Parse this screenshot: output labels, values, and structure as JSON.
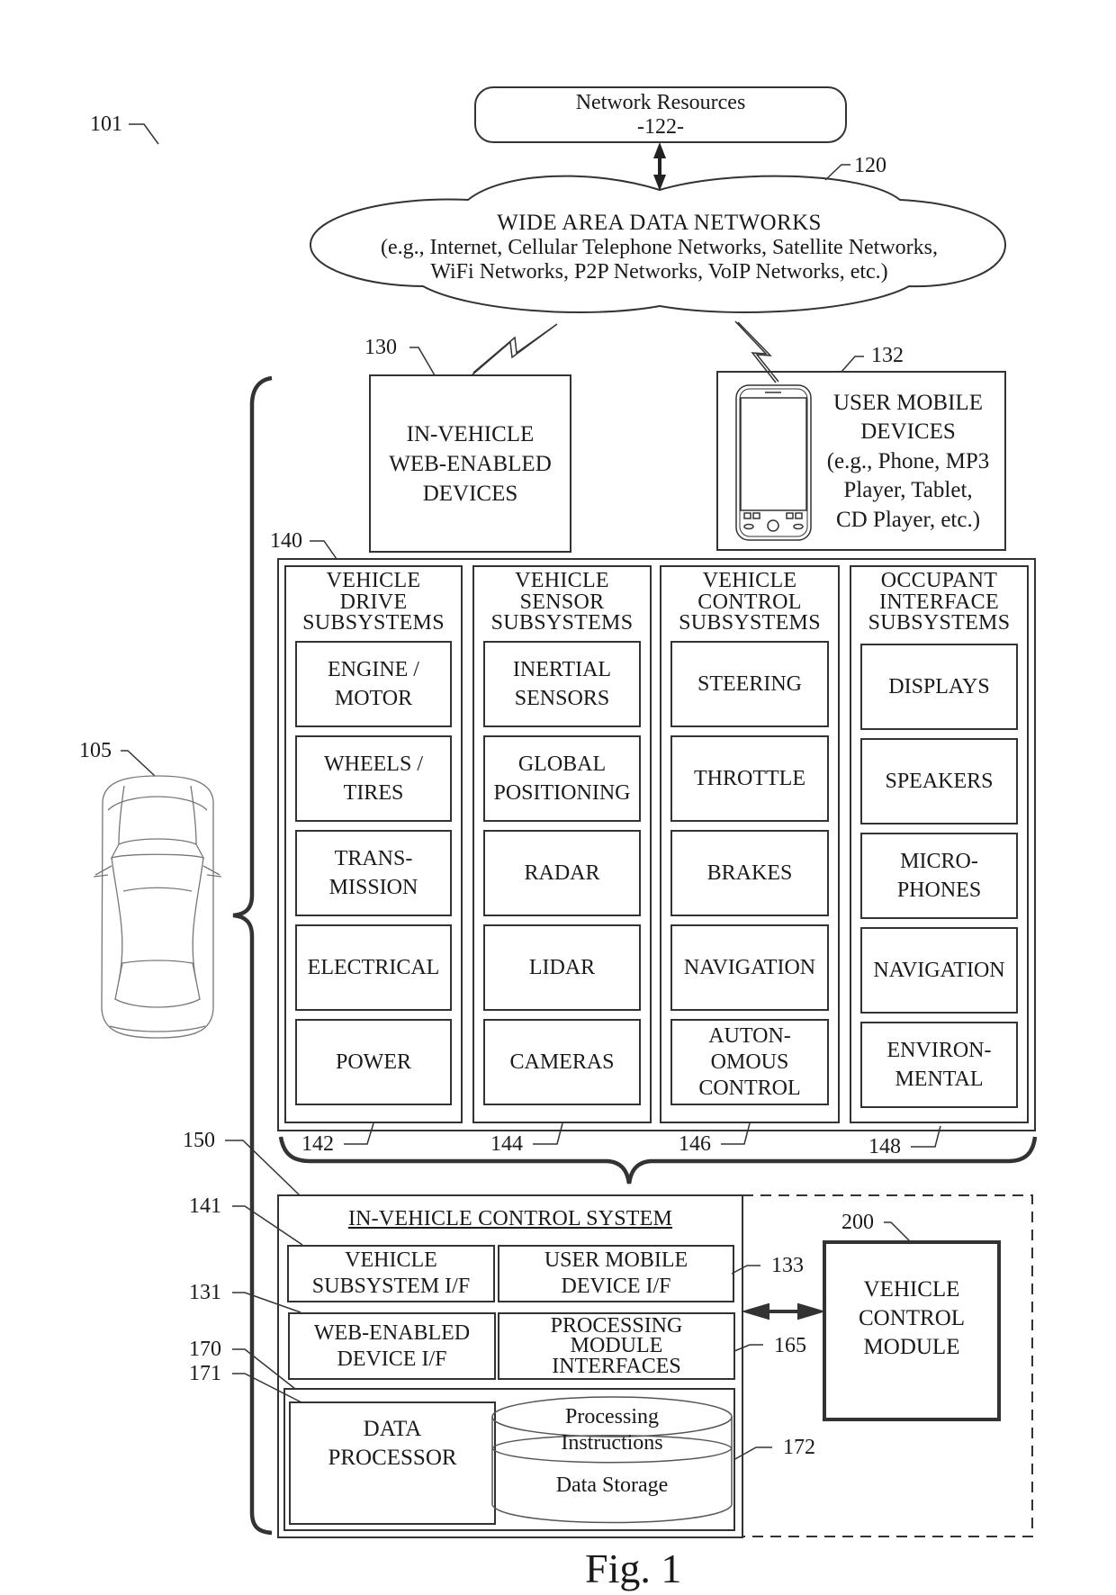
{
  "figure": {
    "caption": "Fig. 1",
    "ref_system": "101",
    "ref_vehicle": "105"
  },
  "network_resources": {
    "title": "Network Resources",
    "ref": "-122-"
  },
  "wide_area_networks": {
    "ref": "120",
    "title": "WIDE AREA DATA NETWORKS",
    "line1": "(e.g., Internet, Cellular Telephone Networks, Satellite Networks,",
    "line2": "WiFi Networks, P2P Networks, VoIP Networks, etc.)"
  },
  "web_enabled_devices": {
    "ref": "130",
    "label": "IN-VEHICLE\nWEB-ENABLED\nDEVICES"
  },
  "user_mobile_devices": {
    "ref": "132",
    "label": "USER MOBILE\nDEVICES\n(e.g., Phone, MP3\nPlayer, Tablet,\nCD Player, etc.)"
  },
  "subsystems_group": {
    "ref": "140",
    "columns": [
      {
        "ref": "142",
        "title": "VEHICLE\nDRIVE\nSUBSYSTEMS",
        "items": [
          "ENGINE /\nMOTOR",
          "WHEELS /\nTIRES",
          "TRANS-\nMISSION",
          "ELECTRICAL",
          "POWER"
        ]
      },
      {
        "ref": "144",
        "title": "VEHICLE\nSENSOR\nSUBSYSTEMS",
        "items": [
          "INERTIAL\nSENSORS",
          "GLOBAL\nPOSITIONING",
          "RADAR",
          "LIDAR",
          "CAMERAS"
        ]
      },
      {
        "ref": "146",
        "title": "VEHICLE\nCONTROL\nSUBSYSTEMS",
        "items": [
          "STEERING",
          "THROTTLE",
          "BRAKES",
          "NAVIGATION",
          "AUTON-\nOMOUS\nCONTROL"
        ]
      },
      {
        "ref": "148",
        "title": "OCCUPANT\nINTERFACE\nSUBSYSTEMS",
        "items": [
          "DISPLAYS",
          "SPEAKERS",
          "MICRO-\nPHONES",
          "NAVIGATION",
          "ENVIRON-\nMENTAL"
        ]
      }
    ]
  },
  "control_system": {
    "ref": "150",
    "title": "IN-VEHICLE CONTROL SYSTEM",
    "vehicle_subsystem_if": {
      "ref": "141",
      "label": "VEHICLE\nSUBSYSTEM I/F"
    },
    "user_mobile_device_if": {
      "ref": "133",
      "label": "USER MOBILE\nDEVICE I/F"
    },
    "web_enabled_device_if": {
      "ref": "131",
      "label": "WEB-ENABLED\nDEVICE I/F"
    },
    "processing_module_interfaces": {
      "ref": "165",
      "label": "PROCESSING\nMODULE\nINTERFACES"
    },
    "compute_block": {
      "ref": "170"
    },
    "data_processor": {
      "ref": "171",
      "label": "DATA\nPROCESSOR"
    },
    "data_storage": {
      "ref": "172",
      "top_label": "Processing",
      "mid_label": "Instructions",
      "bottom_label": "Data Storage"
    }
  },
  "vehicle_control_module": {
    "ref": "200",
    "label": "VEHICLE\nCONTROL\nMODULE"
  }
}
